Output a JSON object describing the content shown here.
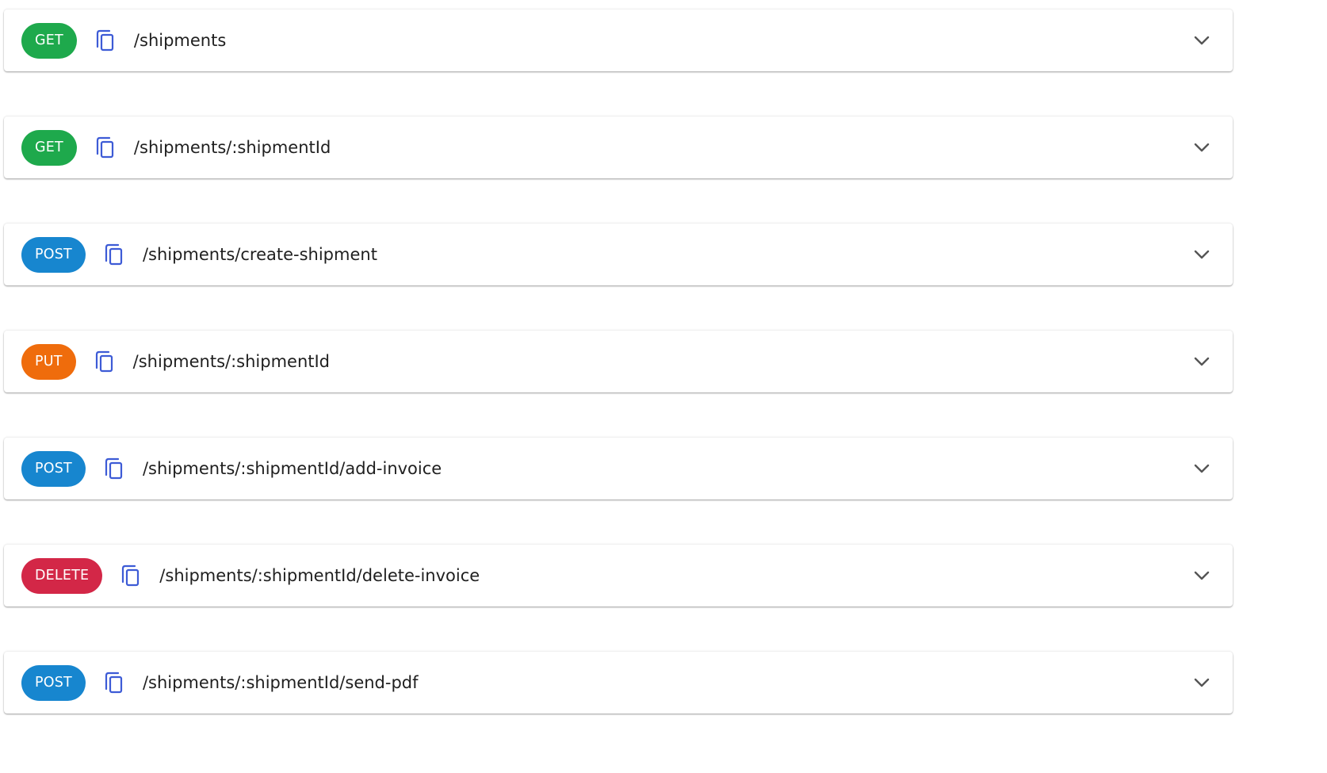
{
  "colors": {
    "GET": "#1ea94c",
    "POST": "#1786cf",
    "PUT": "#ef6c0c",
    "DELETE": "#d32747",
    "copy_icon": "#3d5bd6",
    "chevron_icon": "#555555"
  },
  "icons": {
    "copy": "copy-icon",
    "expand": "chevron-down-icon"
  },
  "endpoints": [
    {
      "method": "GET",
      "path": "/shipments"
    },
    {
      "method": "GET",
      "path": "/shipments/:shipmentId"
    },
    {
      "method": "POST",
      "path": "/shipments/create-shipment"
    },
    {
      "method": "PUT",
      "path": "/shipments/:shipmentId"
    },
    {
      "method": "POST",
      "path": "/shipments/:shipmentId/add-invoice"
    },
    {
      "method": "DELETE",
      "path": "/shipments/:shipmentId/delete-invoice"
    },
    {
      "method": "POST",
      "path": "/shipments/:shipmentId/send-pdf"
    }
  ]
}
